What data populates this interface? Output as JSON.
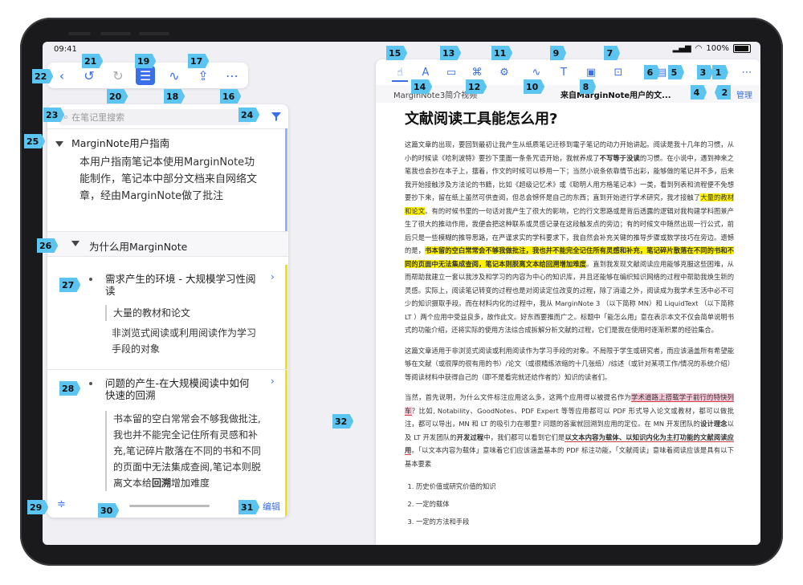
{
  "status": {
    "time": "09:41",
    "battery": "100%"
  },
  "left_toolbar": {
    "icons": [
      "chevron-left-icon",
      "undo-icon",
      "redo-icon",
      "list-icon",
      "mindmap-icon",
      "share-icon",
      "more-icon"
    ]
  },
  "notebook": {
    "search_placeholder": "在笔记里搜索",
    "section1_title": "MarginNote用户指南",
    "section1_text": "本用户指南笔记本使用MarginNote功能制作，笔记本中部分文档来自网络文章，经由MarginNote做了批注",
    "section2_title": "为什么用MarginNote",
    "item1_title": "需求产生的环境 - 大规模学习性阅读",
    "item1_sub1": "大量的教材和论文",
    "item1_sub2": "非浏览式阅读或利用阅读作为学习手段的对象",
    "item2_title": "问题的产生-在大规模阅读中如何快速的回溯",
    "item2_sub_a": "书本留的空白常常会不够我做批注,我也并不能完全记住所有灵感和补充,笔记碎片散落在不同的书和不同的页面中无法集成查阅,笔记本则脱离文本给",
    "item2_sub_bold": "回溯",
    "item2_sub_b": "增加难度",
    "edit_label": "编辑"
  },
  "reader": {
    "tab1": "MarginNote3简介视频",
    "tab2": "来自MarginNote用户的文...",
    "manage_label": "管理",
    "title": "文献阅读工具能怎么用?",
    "p1_a": "这篇文章的出现，要回到最初让我产生从纸质笔记迁移到電子笔记的动力开始讲起。阅读是我十几年的习惯，从小的时候读《哈利波特》要抄下里面一条条咒语开始，我就养成了",
    "p1_b1": "不写等于没读",
    "p1_c": "的习惯。在小说中，遇到神来之笔我也会抄在本子上，摆着，作文的时候可以移用一下；当然小说条依靠情节出彩，能够做的笔记并不多，后来我开始接触涉及方法论的书籍，比如《超级记忆术》或《聪明人用方格笔记本》一类，看到列表和流程便不免想要抄下来，留在纸上虽然可供查阅，但总会憾怀是自己的东西；直到开始进行学术研究，我才接触了",
    "p1_hl1": "大量的教材和论文",
    "p1_d": "。有的时候书里的一句话对我产生了很大的影响，它的行文思路或是背后透露的逻辑对我构建学科图景产生了很大的推动作用，我便会把这种联系或灵感记录在这段触发点的旁边；有的时候文中随然出现一行公式，前后只是一些模糊的推导思路，在严谨求实的学科要求下，我自然会补充关键的推导步骤或数学技巧在旁边。遗憾的是，",
    "p1_hl2": "书本留的空白常常会不够我做批注，我也并不能完全记住所有灵感和补充，笔记碎片散落在不同的书和不同的页面中无法集成查阅，笔记本则脱离文本给回溯增加难度",
    "p1_e": "。直到我发现文献阅读应用能够克服这些困难，从而帮助我建立一套以我涉及和学习的内容为中心的知识库，并且还能够在编织知识网络的过程中帮助我焕生新的灵感。实际上，阅读笔记转变的过程也是对阅读定位改变的过程，除了消遣之外，阅读成为我学术生活中必不可少的知识摄取手段。而在材料内化的过程中，我从 MarginNote 3 （以下简称 MN）和 LiquidText （以下简称 LT ）两个应用中受益良多，故作此文。好东西要推而广之。标题中「能怎么用」意在表示本文不仅会简单说明书式的功能介绍，还将实际的使用方法综合成拆解分析文献的过程，它们是我在使用时逐渐积累的经验集合。",
    "p2": "这篇文章适用于非浏览式阅读或利用阅读作为学习手段的对象。不局限于学生或研究者，而应该涵盖所有希望能够在文献（或很厚的很有用的书）/论文（或很精练浓缩的十几张纸）/综述（或针对某项工作/情况的系统介绍）等阅读材料中获得自己的（即不是看完就还给作者的）知识的读者们。",
    "p3_a": "当然，首先说明，为什么文件标注应用这么多，这两个应用得以被提名作为",
    "p3_pk": "学术道路上搭载学子前行的特快列车",
    "p3_b": "？比如, Notability、GoodNotes、PDF Expert 等等应用都可以 PDF 形式导入论文或教材，都可以做批注，都可以导出，MN 和 LT 的吸引力在哪里? 问题的答案就回溯到应用的定位。在 MN 开发团队的",
    "p3_b1": "设计理念",
    "p3_c": "以及 LT 开发团队的",
    "p3_b2": "开发过程",
    "p3_d": "中，我们都可以看到它们是",
    "p3_ul": "以文本内容为载体、以知识内化为主打功能的文献阅读应用",
    "p3_e": "。「以文本内容为载体」意味着它们应该涵盖基本的 PDF 标注功能，「文献阅读」意味着阅读应该是具有以下基本要素",
    "list": [
      "历史价值或研究价值的知识",
      "一定的载体",
      "一定的方法和手段"
    ]
  },
  "tags": [
    "1",
    "2",
    "3",
    "4",
    "5",
    "6",
    "7",
    "8",
    "9",
    "10",
    "11",
    "12",
    "13",
    "14",
    "15",
    "16",
    "17",
    "18",
    "19",
    "20",
    "21",
    "22",
    "23",
    "24",
    "25",
    "26",
    "27",
    "28",
    "29",
    "30",
    "31",
    "32"
  ]
}
